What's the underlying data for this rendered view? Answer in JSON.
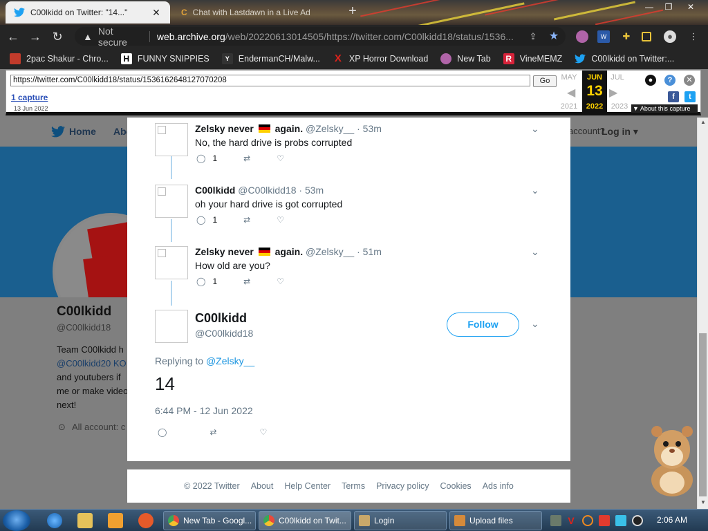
{
  "browser": {
    "tabs": [
      {
        "title": "C00lkidd on Twitter: \"14...\"",
        "active": true
      },
      {
        "title": "Chat with Lastdawn in a Live Ad",
        "active": false
      }
    ],
    "address": {
      "security_label": "Not secure",
      "host": "web.archive.org",
      "path": "/web/20220613014505/https://twitter.com/C00lkidd18/status/1536..."
    },
    "bookmarks": [
      {
        "label": "2pac Shakur - Chro...",
        "icon": "bookmark-favicon-icon",
        "color": "#c23b2b"
      },
      {
        "label": "FUNNY SNIPPIES",
        "icon": "h-logo-icon",
        "color": "#ffffff"
      },
      {
        "label": "EndermanCH/Malw...",
        "icon": "yp-logo-icon",
        "color": "#333333"
      },
      {
        "label": "XP Horror Download",
        "icon": "x-logo-icon",
        "color": "#e0221b"
      },
      {
        "label": "New Tab",
        "icon": "globe-icon",
        "color": "#b064a8"
      },
      {
        "label": "VineMEMZ",
        "icon": "r-logo-icon",
        "color": "#d8233a"
      },
      {
        "label": "C00lkidd on Twitter:...",
        "icon": "twitter-bird-icon",
        "color": "#1da1f2"
      }
    ]
  },
  "wayback": {
    "url": "https://twitter.com/C00lkidd18/status/1536162648127070208",
    "go_label": "Go",
    "captures_label": "1 capture",
    "capture_date": "13 Jun 2022",
    "prev_month": "MAY",
    "cur_month": "JUN",
    "next_month": "JUL",
    "cur_day": "13",
    "prev_year": "2021",
    "cur_year": "2022",
    "next_year": "2023",
    "about_label": "▼ About this capture"
  },
  "background_page": {
    "nav_home": "Home",
    "nav_about_partial": "Abo",
    "nav_account": "account?",
    "nav_login": "Log in ▾",
    "profile_name": "C00lkidd",
    "profile_handle": "@C00lkidd18",
    "bio_line1": "Team C00lkidd h",
    "bio_line2": "@C00lkidd20 KO",
    "bio_line3": "and youtubers if",
    "bio_line4": "me or make video about me, you will be",
    "bio_line5": "next!",
    "location": "All account: c"
  },
  "tweet": {
    "replies": [
      {
        "name": "Zelsky never",
        "flag": true,
        "name_suffix": "again.",
        "handle": "@Zelsky__",
        "time": "· 53m",
        "text": "No, the hard drive is probs corrupted",
        "reply_count": "1"
      },
      {
        "name": "C00lkidd",
        "flag": false,
        "name_suffix": "",
        "handle": "@C00lkidd18",
        "time": "· 53m",
        "text": "oh your hard drive is got corrupted",
        "reply_count": "1"
      },
      {
        "name": "Zelsky never",
        "flag": true,
        "name_suffix": "again.",
        "handle": "@Zelsky__",
        "time": "· 51m",
        "text": "How old are you?",
        "reply_count": "1"
      }
    ],
    "main": {
      "name": "C00lkidd",
      "handle": "@C00lkidd18",
      "follow_label": "Follow",
      "replying_prefix": "Replying to",
      "replying_to": "@Zelsky__",
      "text": "14",
      "timestamp": "6:44 PM - 12 Jun 2022"
    }
  },
  "footer": {
    "links": [
      "© 2022 Twitter",
      "About",
      "Help Center",
      "Terms",
      "Privacy policy",
      "Cookies",
      "Ads info"
    ]
  },
  "taskbar": {
    "tasks": [
      {
        "label": "New Tab - Googl...",
        "icon_color": "#e84a3c"
      },
      {
        "label": "C00lkidd on Twit...",
        "icon_color": "#e84a3c"
      },
      {
        "label": "Login",
        "icon_color": "#c9a86a"
      },
      {
        "label": "Upload files",
        "icon_color": "#d58a3a"
      }
    ],
    "clock": "2:06 AM"
  },
  "colors": {
    "twitter_blue": "#1da1f2",
    "wayback_yellow": "#ffd300",
    "thread_line": "#b3d6ef"
  }
}
